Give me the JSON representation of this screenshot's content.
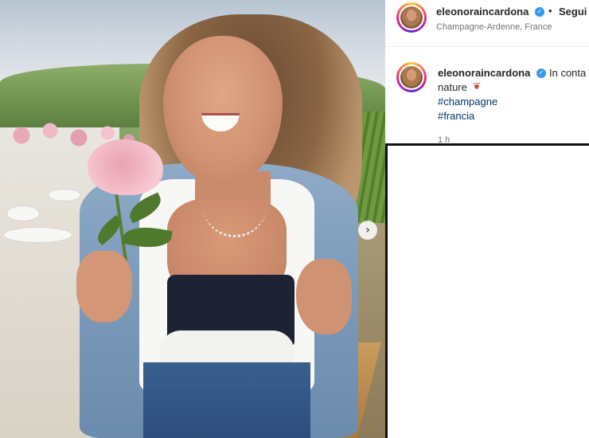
{
  "post": {
    "username": "eleonoraincardona",
    "follow_label": "Segui",
    "separator": "•",
    "location": "Champagne-Ardenne, France",
    "caption": {
      "username": "eleonoraincardona",
      "text_line1": "In conta",
      "text_line2": "nature",
      "hashtags": [
        "#champagne",
        "#francia"
      ]
    },
    "time": "1 h"
  },
  "icons": {
    "verified": "verified-badge-icon",
    "rose_emoji": "rose-icon",
    "next": "chevron-right-icon"
  },
  "colors": {
    "verified": "#3897f0",
    "hashtag": "#00376b",
    "text": "#262626",
    "muted": "#737373"
  }
}
